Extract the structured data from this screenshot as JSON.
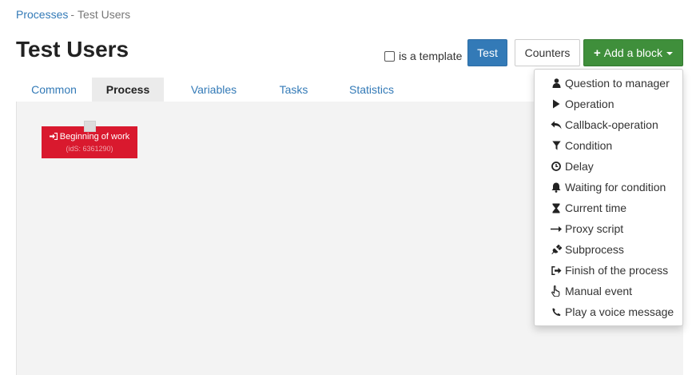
{
  "breadcrumb": {
    "parent": "Processes",
    "separator": "-",
    "current": "Test Users"
  },
  "page": {
    "title": "Test Users"
  },
  "toolbar": {
    "template_label": "is a template",
    "test_label": "Test",
    "counters_label": "Counters",
    "add_block_label": "Add a block",
    "colors": {
      "test": "#337ab7",
      "add_block": "#3f8f3b"
    }
  },
  "tabs": [
    "Common",
    "Process",
    "Variables",
    "Tasks",
    "Statistics"
  ],
  "active_tab": "Process",
  "canvas": {
    "start_block": {
      "title": "Beginning of work",
      "ids": "(idS: 6361290)",
      "color": "#d9192e"
    }
  },
  "add_block_menu": [
    {
      "label": "Question to manager",
      "icon": "user-icon"
    },
    {
      "label": "Operation",
      "icon": "play-icon"
    },
    {
      "label": "Callback-operation",
      "icon": "reply-icon"
    },
    {
      "label": "Condition",
      "icon": "filter-icon"
    },
    {
      "label": "Delay",
      "icon": "clock-icon"
    },
    {
      "label": "Waiting for condition",
      "icon": "bell-icon"
    },
    {
      "label": "Current time",
      "icon": "hourglass-icon"
    },
    {
      "label": "Proxy script",
      "icon": "arrow-right-icon"
    },
    {
      "label": "Subprocess",
      "icon": "plug-icon"
    },
    {
      "label": "Finish of the process",
      "icon": "sign-out-icon"
    },
    {
      "label": "Manual event",
      "icon": "hand-pointer-icon"
    },
    {
      "label": "Play a voice message",
      "icon": "phone-icon"
    }
  ]
}
